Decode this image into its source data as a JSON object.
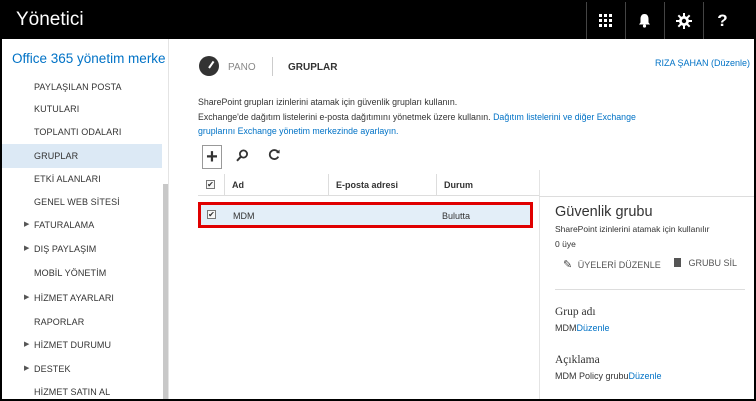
{
  "topbar": {
    "title": "Yönetici",
    "icons": [
      "app-launcher-icon",
      "bell-icon",
      "gear-icon",
      "help-icon"
    ],
    "help_glyph": "?"
  },
  "sidebar": {
    "title": "Office 365 yönetim merke",
    "items": [
      {
        "label": "PAYLAŞILAN POSTA",
        "expandable": false
      },
      {
        "label": "KUTULARI",
        "expandable": false
      },
      {
        "label": "TOPLANTI ODALARI",
        "expandable": false
      },
      {
        "label": "GRUPLAR",
        "expandable": false,
        "selected": true
      },
      {
        "label": "ETKİ ALANLARI",
        "expandable": false
      },
      {
        "label": "GENEL WEB SİTESİ",
        "expandable": false
      },
      {
        "label": "FATURALAMA",
        "expandable": true
      },
      {
        "label": "DIŞ PAYLAŞIM",
        "expandable": true
      },
      {
        "label": "MOBİL YÖNETİM",
        "expandable": false
      },
      {
        "label": "HİZMET AYARLARI",
        "expandable": true
      },
      {
        "label": "RAPORLAR",
        "expandable": false
      },
      {
        "label": "HİZMET DURUMU",
        "expandable": true
      },
      {
        "label": "DESTEK",
        "expandable": true
      },
      {
        "label": "HİZMET SATIN AL",
        "expandable": false
      }
    ]
  },
  "header": {
    "pano": "PANO",
    "title": "GRUPLAR",
    "user": "RIZA ŞAHAN (Düzenle)"
  },
  "description": {
    "line1": "SharePoint grupları izinlerini atamak için güvenlik grupları kullanın.",
    "line2_text": "Exchange'de dağıtım listelerini e-posta dağıtımını yönetmek üzere kullanın. ",
    "line2_link": "Dağıtım listelerini ve diğer Exchange",
    "line3_link": "gruplarını Exchange yönetim merkezinde ayarlayın."
  },
  "toolbar": {
    "add": "+",
    "search_icon": "search-icon",
    "refresh_icon": "refresh-icon"
  },
  "table": {
    "columns": [
      "Ad",
      "E-posta adresi",
      "Durum"
    ],
    "rows": [
      {
        "name": "MDM",
        "email": "",
        "status": "Bulutta",
        "checked": true
      }
    ]
  },
  "detail": {
    "title": "Güvenlik grubu",
    "description": "SharePoint izinlerini atamak için kullanılır",
    "members": "0 üye",
    "edit_members": "ÜYELERİ DÜZENLE",
    "delete_group": "GRUBU SİL",
    "group_name_label": "Grup adı",
    "group_name_value": "MDM",
    "group_name_edit": "Düzenle",
    "desc_label": "Açıklama",
    "desc_value": "MDM Policy grubu",
    "desc_edit": "Düzenle"
  }
}
